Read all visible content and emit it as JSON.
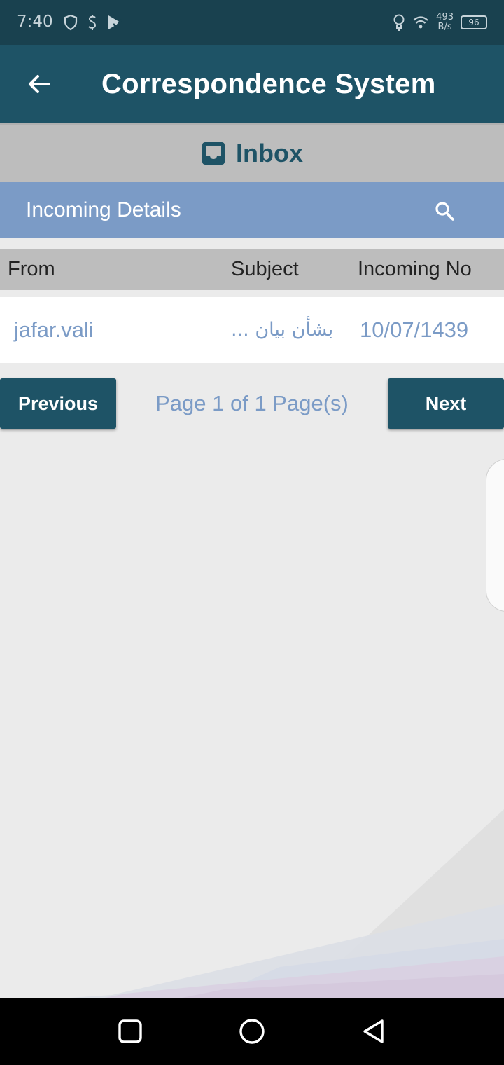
{
  "status_bar": {
    "time": "7:40",
    "net_speed_value": "493",
    "net_speed_unit": "B/s",
    "battery": "96",
    "icons": [
      "shield-icon",
      "dollar-icon",
      "play-store-icon",
      "lightbulb-icon",
      "wifi-icon"
    ]
  },
  "app_bar": {
    "title": "Correspondence System",
    "back_icon": "arrow-back-icon"
  },
  "section": {
    "title": "Inbox",
    "icon": "inbox-icon"
  },
  "details": {
    "label": "Incoming Details",
    "search_icon": "search-icon"
  },
  "table": {
    "columns": [
      "From",
      "Subject",
      "Incoming No"
    ],
    "rows": [
      {
        "from": "jafar.vali",
        "subject": "بشأن بيان ...",
        "incoming_no": "10/07/1439"
      }
    ]
  },
  "pager": {
    "previous_label": "Previous",
    "next_label": "Next",
    "page_info": "Page 1 of 1 Page(s)"
  },
  "colors": {
    "status_bar": "#19414f",
    "primary": "#1e5366",
    "accent": "#7b9bc6",
    "band_gray": "#bdbdbd",
    "background": "#ebebeb"
  }
}
